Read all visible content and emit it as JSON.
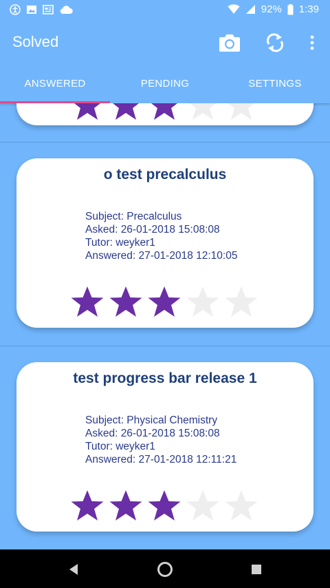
{
  "statusbar": {
    "battery": "92%",
    "time": "1:39"
  },
  "appbar": {
    "title": "Solved"
  },
  "tabs": [
    {
      "label": "ANSWERED",
      "active": true
    },
    {
      "label": "PENDING",
      "active": false
    },
    {
      "label": "SETTINGS",
      "active": false
    }
  ],
  "colors": {
    "primary": "#71b6fd",
    "star_filled": "#6a2ea6",
    "star_empty": "#eeeeee",
    "title_text": "#1f3f7a",
    "info_text": "#2a3a8c",
    "tab_indicator": "#e5488b"
  },
  "cards": [
    {
      "title": "o test precalculus",
      "subject": "Subject: Precalculus",
      "asked": "Asked: 26-01-2018 15:08:08",
      "tutor": "Tutor: weyker1",
      "answered": "Answered: 27-01-2018 12:10:05",
      "rating": 3,
      "max_rating": 5
    },
    {
      "title": "test progress bar release 1",
      "subject": "Subject: Physical Chemistry",
      "asked": "Asked: 26-01-2018 15:08:08",
      "tutor": "Tutor: weyker1",
      "answered": "Answered: 27-01-2018 12:11:21",
      "rating": 3,
      "max_rating": 5
    }
  ],
  "partial_card": {
    "rating": 3,
    "max_rating": 5
  }
}
